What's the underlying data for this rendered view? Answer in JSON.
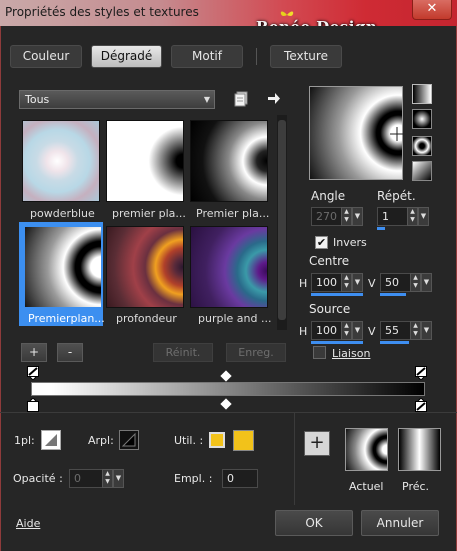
{
  "window": {
    "title": "Propriétés des styles et textures",
    "close_glyph": "✕"
  },
  "watermark": {
    "text": "Renée Design"
  },
  "tabs": [
    {
      "label": "Couleur"
    },
    {
      "label": "Dégradé"
    },
    {
      "label": "Motif"
    },
    {
      "label": "Texture"
    }
  ],
  "category": {
    "selected": "Tous"
  },
  "gradients": [
    {
      "label": "powderblue"
    },
    {
      "label": "premier pla..."
    },
    {
      "label": "Premier pla..."
    },
    {
      "label": "Premierplan..."
    },
    {
      "label": "profondeur"
    },
    {
      "label": "purple and ..."
    }
  ],
  "list_buttons": {
    "add": "+",
    "remove": "-",
    "reset": "Réinit.",
    "save": "Enreg."
  },
  "angle": {
    "label": "Angle",
    "value": "270"
  },
  "repeat": {
    "label": "Répét.",
    "value": "1"
  },
  "invert": {
    "label": "Invers",
    "checked": true
  },
  "center": {
    "label": "Centre",
    "h_label": "H",
    "h_value": "100",
    "v_label": "V",
    "v_value": "50"
  },
  "source": {
    "label": "Source",
    "h_label": "H",
    "h_value": "100",
    "v_label": "V",
    "v_value": "55"
  },
  "link": {
    "label": "Liaison",
    "checked": false
  },
  "bottom": {
    "fg_label": "1pl:",
    "bg_label": "Arpl:",
    "user_label": "Util. :",
    "opacity_label": "Opacité :",
    "opacity_value": "0",
    "location_label": "Empl. :",
    "location_value": "0",
    "current_label": "Actuel",
    "previous_label": "Préc.",
    "add_glyph": "+",
    "user_color": "#f2c21a"
  },
  "footer": {
    "help": "Aide",
    "ok": "OK",
    "cancel": "Annuler"
  }
}
